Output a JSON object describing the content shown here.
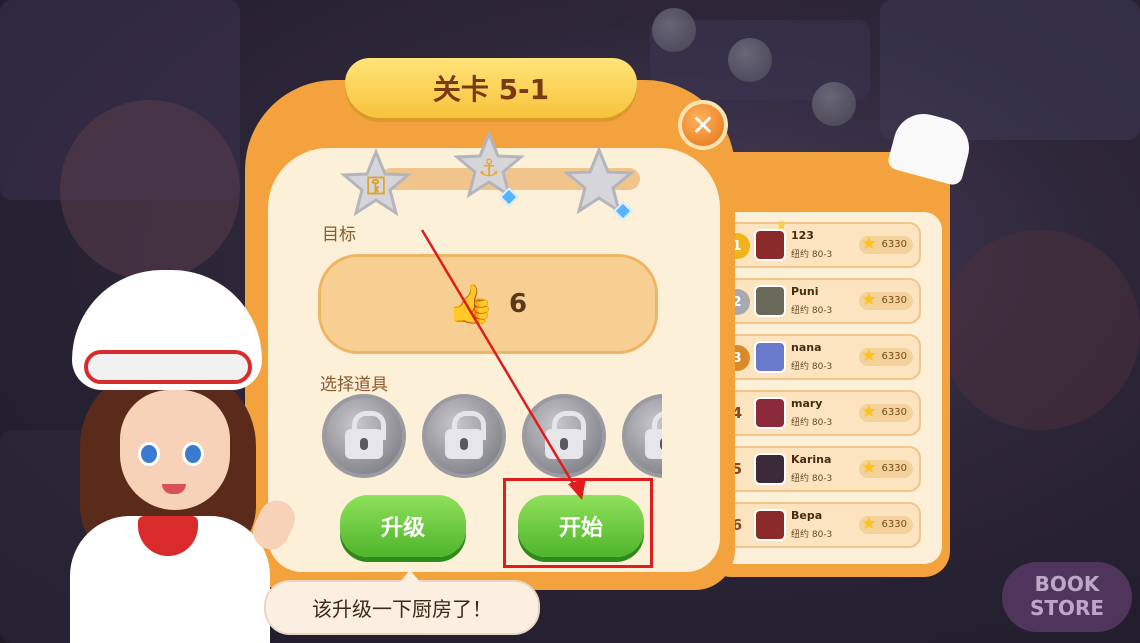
{
  "level": {
    "title": "关卡 5-1"
  },
  "stars": [
    {
      "icon": "key-star-icon",
      "filled": false
    },
    {
      "icon": "anchor-star-icon",
      "filled": true,
      "gem": true
    },
    {
      "icon": "empty-star-icon",
      "filled": false,
      "gem": true
    }
  ],
  "goal": {
    "label": "目标",
    "icon": "thumbs-up-icon",
    "count": "6"
  },
  "props": {
    "label": "选择道具",
    "slots": [
      "lock-icon",
      "lock-icon",
      "lock-icon",
      "lock-icon"
    ]
  },
  "buttons": {
    "upgrade": "升级",
    "start": "开始"
  },
  "speech": "该升级一下厨房了！",
  "leaderboard": [
    {
      "rank": "1",
      "badge": "gold-medal-icon",
      "name": "123",
      "level": "纽约 80-3",
      "score": "6330",
      "crown": true
    },
    {
      "rank": "2",
      "badge": "silver-medal-icon",
      "name": "Puni",
      "level": "纽约 80-3",
      "score": "6330"
    },
    {
      "rank": "3",
      "badge": "bronze-medal-icon",
      "name": "nana",
      "level": "纽约 80-3",
      "score": "6330"
    },
    {
      "rank": "4",
      "name": "mary",
      "level": "纽约 80-3",
      "score": "6330"
    },
    {
      "rank": "5",
      "name": "Karina",
      "level": "纽约 80-3",
      "score": "6330"
    },
    {
      "rank": "6",
      "name": "Вера",
      "level": "纽约 80-3",
      "score": "6330"
    }
  ],
  "background": {
    "sign": "BOOK STORE"
  },
  "colors": {
    "panel_orange": "#f3a23d",
    "panel_cream": "#fdf0d8",
    "button_green": "#4fb52c",
    "highlight_red": "#e01c1c",
    "title_text": "#7a3a10"
  }
}
